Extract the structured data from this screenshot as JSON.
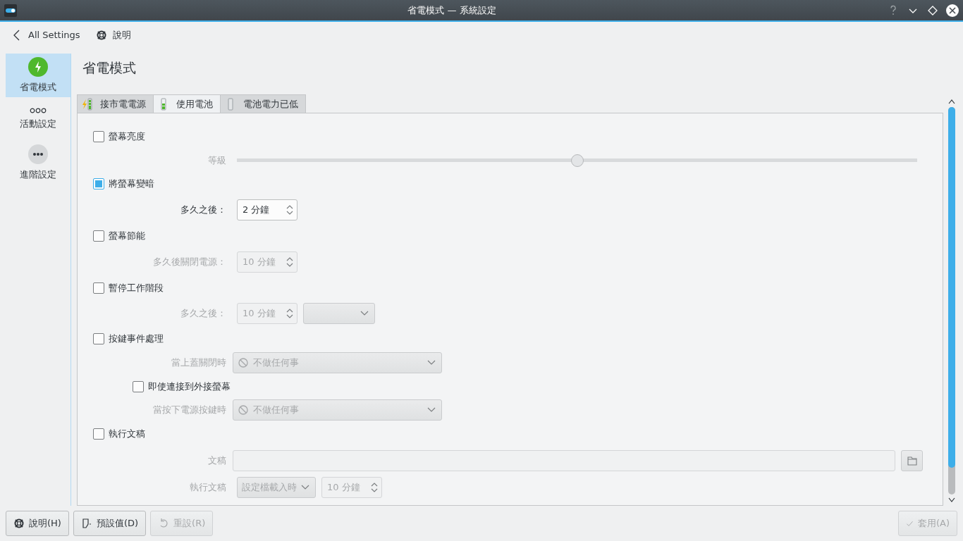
{
  "window": {
    "title": "省電模式 — 系統設定"
  },
  "toolbar": {
    "back_label": "All Settings",
    "help_label": "說明"
  },
  "sidebar": {
    "items": [
      {
        "label": "省電模式",
        "kind": "power",
        "selected": true
      },
      {
        "label": "活動設定",
        "kind": "activities",
        "selected": false
      },
      {
        "label": "進階設定",
        "kind": "advanced",
        "selected": false
      }
    ]
  },
  "page_title": "省電模式",
  "tabs": [
    {
      "label": "接市電電源",
      "kind": "charging",
      "selected": false
    },
    {
      "label": "使用電池",
      "kind": "battery",
      "selected": true
    },
    {
      "label": "電池電力已低",
      "kind": "low",
      "selected": false
    }
  ],
  "form": {
    "rows": [
      {
        "kind": "check",
        "label": "螢幕亮度",
        "checked": false
      },
      {
        "kind": "slider",
        "label": "等級",
        "level": 0.5,
        "disabled": true
      },
      {
        "kind": "check",
        "label": "將螢幕變暗",
        "checked": true
      },
      {
        "kind": "spin",
        "label": "多久之後：",
        "value": "2 分鐘",
        "disabled": false
      },
      {
        "kind": "check",
        "label": "螢幕節能",
        "checked": false
      },
      {
        "kind": "spin",
        "label": "多久後關閉電源：",
        "value": "10 分鐘",
        "disabled": true
      },
      {
        "kind": "check",
        "label": "暫停工作階段",
        "checked": false
      },
      {
        "kind": "spincombo",
        "label": "多久之後：",
        "value": "10 分鐘",
        "disabled": true
      },
      {
        "kind": "check",
        "label": "按鍵事件處理",
        "checked": false
      },
      {
        "kind": "combo",
        "label": "當上蓋關閉時",
        "value": "不做任何事",
        "disabled": true
      },
      {
        "kind": "subcheck",
        "label": "即使連接到外接螢幕",
        "checked": false
      },
      {
        "kind": "combo",
        "label": "當按下電源按鍵時",
        "value": "不做任何事",
        "disabled": true
      },
      {
        "kind": "check",
        "label": "執行文稿",
        "checked": false
      },
      {
        "kind": "file",
        "label": "文稿",
        "disabled": true
      },
      {
        "kind": "combospin",
        "label": "執行文稿",
        "combo": "設定檔載入時",
        "value": "10 分鐘",
        "disabled": true
      }
    ]
  },
  "footer": {
    "left": [
      {
        "label": "說明(H)",
        "kind": "help",
        "disabled": false
      },
      {
        "label": "預設值(D)",
        "kind": "defaults",
        "disabled": false
      },
      {
        "label": "重設(R)",
        "kind": "reset",
        "disabled": true
      }
    ],
    "right": [
      {
        "label": "套用(A)",
        "kind": "apply",
        "disabled": true
      }
    ]
  }
}
